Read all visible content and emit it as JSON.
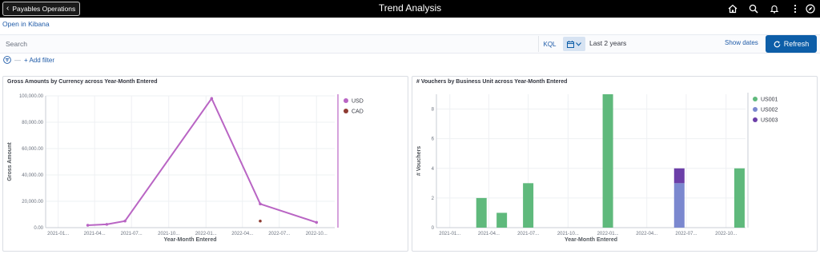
{
  "header": {
    "back_label": "Payables Operations",
    "title": "Trend Analysis",
    "icons": [
      "home-icon",
      "search-icon",
      "bell-icon",
      "more-vertical-icon",
      "compass-icon"
    ]
  },
  "kibana_link": "Open in Kibana",
  "query_bar": {
    "search_placeholder": "Search",
    "kql_label": "KQL",
    "date_range": "Last 2 years",
    "show_dates": "Show dates",
    "refresh_label": "Refresh"
  },
  "filters": {
    "add_filter_label": "+ Add filter"
  },
  "colors": {
    "usd": "#b965c4",
    "cad": "#8e3b32",
    "us001": "#5fb97c",
    "us002": "#7b88cf",
    "us003": "#6c3fa8",
    "accent": "#0d5ea8"
  },
  "chart_data": [
    {
      "type": "line",
      "title": "Gross Amounts by Currency across Year-Month Entered",
      "xlabel": "Year-Month Entered",
      "ylabel": "Gross Amount",
      "x_tick_labels": [
        "2021-01...",
        "2021-04...",
        "2021-07...",
        "2021-10...",
        "2022-01...",
        "2022-04...",
        "2022-07...",
        "2022-10..."
      ],
      "y_ticks": [
        0,
        20000,
        40000,
        60000,
        80000,
        100000
      ],
      "y_tick_labels": [
        "0.00",
        "20,000.00",
        "40,000.00",
        "60,000.00",
        "80,000.00",
        "100,000.00"
      ],
      "ylim": [
        0,
        100000
      ],
      "xlim": [
        "2020-12-01",
        "2022-11-15"
      ],
      "series": [
        {
          "name": "USD",
          "points": [
            {
              "x": "2021-03-15",
              "y": 1800
            },
            {
              "x": "2021-05-01",
              "y": 2500
            },
            {
              "x": "2021-06-15",
              "y": 5000
            },
            {
              "x": "2022-01-15",
              "y": 98000
            },
            {
              "x": "2022-05-15",
              "y": 18000
            },
            {
              "x": "2022-10-01",
              "y": 4000
            }
          ]
        },
        {
          "name": "CAD",
          "points": [
            {
              "x": "2022-05-15",
              "y": 5000
            }
          ]
        }
      ],
      "legend_position": "top-right",
      "grid": true
    },
    {
      "type": "bar",
      "title": "# Vouchers by Business Unit across Year-Month Entered",
      "xlabel": "Year-Month Entered",
      "ylabel": "# Vouchers",
      "x_tick_labels": [
        "2021-01...",
        "2021-04...",
        "2021-07...",
        "2021-10...",
        "2022-01...",
        "2022-04...",
        "2022-07...",
        "2022-10..."
      ],
      "y_ticks": [
        0,
        2,
        4,
        6,
        8
      ],
      "ylim": [
        0,
        9
      ],
      "xlim": [
        "2020-12-01",
        "2022-11-15"
      ],
      "series": [
        {
          "name": "US001",
          "points": [
            {
              "x": "2021-03-15",
              "y": 2
            },
            {
              "x": "2021-05-01",
              "y": 1
            },
            {
              "x": "2021-07-01",
              "y": 3
            },
            {
              "x": "2022-01-01",
              "y": 9
            },
            {
              "x": "2022-11-01",
              "y": 4
            }
          ]
        },
        {
          "name": "US002",
          "points": [
            {
              "x": "2022-06-15",
              "y": 3
            }
          ]
        },
        {
          "name": "US003",
          "points": [
            {
              "x": "2022-06-15",
              "y": 1
            }
          ]
        }
      ],
      "stacked": true,
      "legend_position": "top-right",
      "grid": true
    }
  ]
}
